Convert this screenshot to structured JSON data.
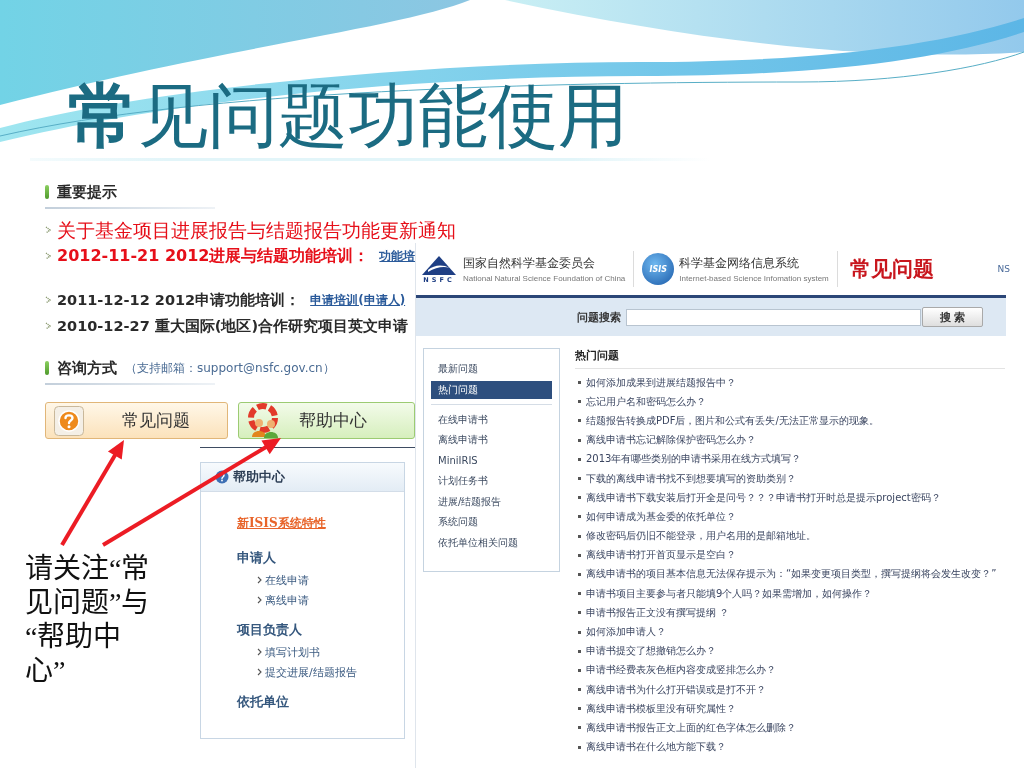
{
  "slide": {
    "title": "**常**见问题功能使用"
  },
  "notice_screenshot": {
    "notice_heading": "重要提示",
    "notices": [
      {
        "kind": "headline",
        "text": "关于基金项目进展报告与结题报告功能更新通知"
      },
      {
        "kind": "highlight",
        "text": "2012-11-21 2012进展与结题功能培训：",
        "link": "功能培"
      },
      {
        "kind": "normal",
        "text": "2011-12-12 2012申请功能培训：",
        "link": "申请培训(申请人)"
      },
      {
        "kind": "normal",
        "text": "2010-12-27 重大国际(地区)合作研究项目英文申请"
      }
    ],
    "contact_heading": "咨询方式",
    "contact_note": "（支持邮箱：support@nsfc.gov.cn）",
    "buttons": [
      {
        "kind": "faq",
        "label": "常见问题"
      },
      {
        "kind": "help",
        "label": "帮助中心"
      }
    ]
  },
  "faq_screenshot": {
    "org_logo_text": "NSFC",
    "org_name": "国家自然科学基金委员会",
    "org_name_en": "National Natural Science Foundation of China",
    "system_logo_text": "ISIS",
    "system_name": "科学基金网络信息系统",
    "system_name_en": "Internet-based Science Infomation system",
    "page_title": "常见问题",
    "corner_text": "NS",
    "search": {
      "label": "问题搜索",
      "button": "搜 索"
    },
    "sidebar": {
      "groups": [
        {
          "items": [
            {
              "label": "最新问题",
              "selected": false
            },
            {
              "label": "热门问题",
              "selected": true
            }
          ]
        },
        {
          "items": [
            {
              "label": "在线申请书",
              "selected": false
            },
            {
              "label": "离线申请书",
              "selected": false
            },
            {
              "label": "MiniIRIS",
              "selected": false
            },
            {
              "label": "计划任务书",
              "selected": false
            },
            {
              "label": "进展/结题报告",
              "selected": false
            },
            {
              "label": "系统问题",
              "selected": false
            },
            {
              "label": "依托单位相关问题",
              "selected": false
            }
          ]
        }
      ]
    },
    "list_heading": "热门问题",
    "questions": [
      "如何添加成果到进展结题报告中？",
      "忘记用户名和密码怎么办？",
      "结题报告转换成PDF后，图片和公式有丢失/无法正常显示的现象。",
      "离线申请书忘记解除保护密码怎么办？",
      "2013年有哪些类别的申请书采用在线方式填写？",
      "下载的离线申请书找不到想要填写的资助类别？",
      "离线申请书下载安装后打开全是问号？？？申请书打开时总是提示project密码？",
      "如何申请成为基金委的依托单位？",
      "修改密码后仍旧不能登录，用户名用的是邮箱地址。",
      "离线申请书打开首页显示是空白？",
      "离线申请书的项目基本信息无法保存提示为：“如果变更项目类型，撰写提纲将会发生改变？”",
      "申请书项目主要参与者只能填9个人吗？如果需增加，如何操作？",
      "申请书报告正文没有撰写提纲 ？",
      "如何添加申请人？",
      "申请书提交了想撤销怎么办？",
      "申请书经费表灰色框内容变成竖排怎么办？",
      "离线申请书为什么打开错误或是打不开？",
      "离线申请书模板里没有研究属性？",
      "离线申请书报告正文上面的红色字体怎么删除？",
      "离线申请书在什么地方能下载？"
    ]
  },
  "help_screenshot": {
    "title": "帮助中心",
    "feature_link": "新ISIS系统特性",
    "groups": [
      {
        "heading": "申请人",
        "links": [
          "在线申请",
          "离线申请"
        ]
      },
      {
        "heading": "项目负责人",
        "links": [
          "填写计划书",
          "提交进展/结题报告"
        ]
      },
      {
        "heading": "依托单位"
      }
    ]
  },
  "callout": "请关注“常见问题”与“帮助中心”"
}
